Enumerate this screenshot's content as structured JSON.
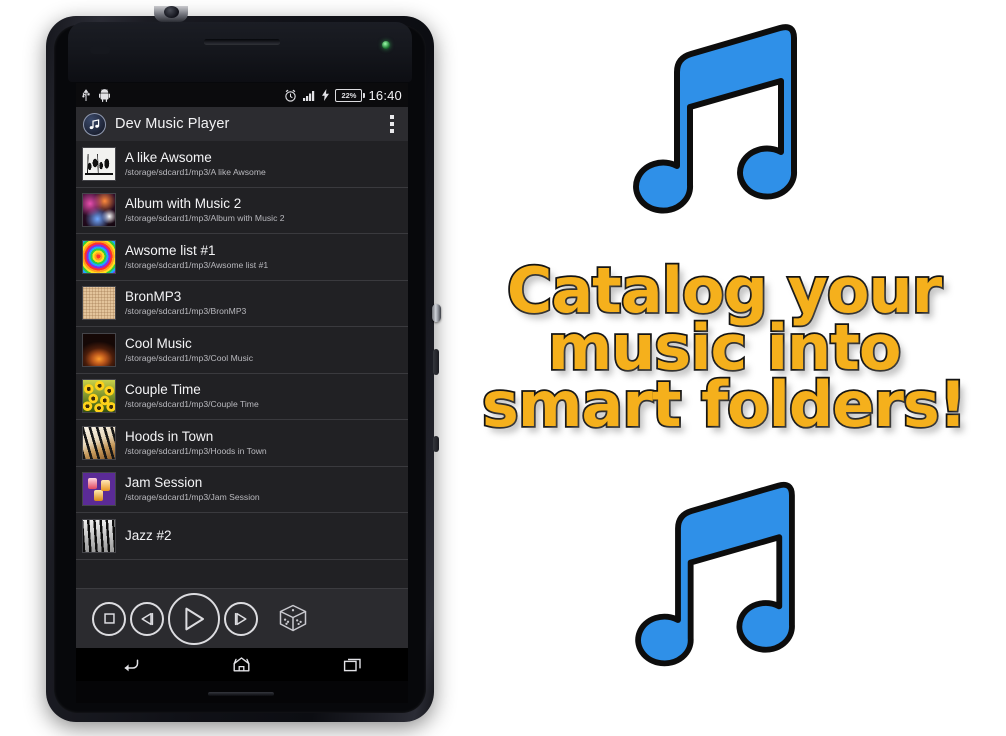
{
  "phone": {
    "status_bar": {
      "icons_left": [
        "usb-icon",
        "android-debug-icon"
      ],
      "alarm_icon": "alarm-clock-icon",
      "signal_icon": "signal-bars-icon",
      "charging_icon": "charging-bolt-icon",
      "battery_percent": "22%",
      "time": "16:40"
    },
    "action_bar": {
      "app_icon": "music-note-circle-icon",
      "title": "Dev Music Player",
      "overflow_icon": "overflow-menu-icon"
    },
    "songs": [
      {
        "title": "A like Awsome",
        "path": "/storage/sdcard1/mp3/A like Awsome",
        "art": "t-sketch"
      },
      {
        "title": "Album with Music 2",
        "path": "/storage/sdcard1/mp3/Album with Music 2",
        "art": "t-concert"
      },
      {
        "title": "Awsome list #1",
        "path": "/storage/sdcard1/mp3/Awsome list #1",
        "art": "t-spiral"
      },
      {
        "title": "BronMP3",
        "path": "/storage/sdcard1/mp3/BronMP3",
        "art": "t-linen"
      },
      {
        "title": "Cool Music",
        "path": "/storage/sdcard1/mp3/Cool Music",
        "art": "t-glow"
      },
      {
        "title": "Couple Time",
        "path": "/storage/sdcard1/mp3/Couple Time",
        "art": "t-sunflower"
      },
      {
        "title": "Hoods in Town",
        "path": "/storage/sdcard1/mp3/Hoods in Town",
        "art": "t-piano"
      },
      {
        "title": "Jam Session",
        "path": "/storage/sdcard1/mp3/Jam Session",
        "art": "t-jars"
      },
      {
        "title": "Jazz #2",
        "path": "",
        "art": "t-keys-bw"
      }
    ],
    "player_controls": [
      {
        "name": "stop-button",
        "icon": "stop-icon"
      },
      {
        "name": "previous-button",
        "icon": "previous-icon"
      },
      {
        "name": "play-button",
        "icon": "play-icon"
      },
      {
        "name": "next-button",
        "icon": "next-icon"
      },
      {
        "name": "shuffle-button",
        "icon": "dice-shuffle-icon"
      }
    ],
    "nav_bar": [
      {
        "name": "back-button",
        "icon": "back-arrow-icon"
      },
      {
        "name": "home-button",
        "icon": "home-icon"
      },
      {
        "name": "recents-button",
        "icon": "recents-icon"
      }
    ]
  },
  "promo": {
    "lines": [
      "Catalog your",
      "music into",
      "smart folders!"
    ],
    "text_color": "#f5b01c",
    "outline_color": "#141414",
    "note_color": "#2f90e8",
    "note_outline": "#0d0d0d"
  }
}
